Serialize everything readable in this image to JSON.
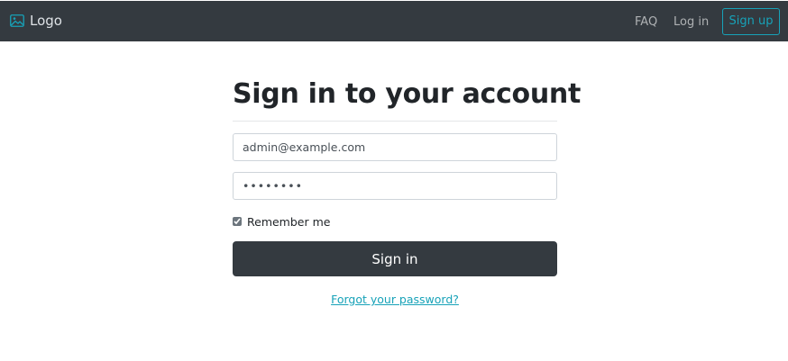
{
  "navbar": {
    "brand_label": "Logo",
    "brand_icon": "image-icon",
    "links": {
      "faq": "FAQ",
      "login": "Log in"
    },
    "signup_label": "Sign up",
    "colors": {
      "background": "#343a40",
      "accent": "#17a2b8"
    }
  },
  "form": {
    "title": "Sign in to your account",
    "email_value": "admin@example.com",
    "password_value": "password",
    "remember_label": "Remember me",
    "remember_checked": true,
    "submit_label": "Sign in",
    "forgot_label": "Forgot your password?"
  }
}
